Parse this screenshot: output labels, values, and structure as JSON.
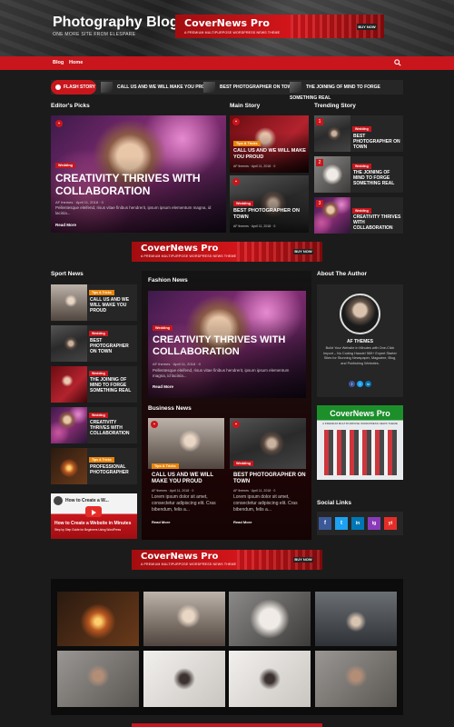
{
  "header": {
    "title": "Photography Blog",
    "tagline": "ONE MORE SITE FROM ELESPARE"
  },
  "ad": {
    "title": "CoverNews Pro",
    "subtitle": "A PREMIUM MULTIPURPOSE WORDPRESS NEWS THEME",
    "button": "BUY NOW"
  },
  "nav": {
    "items": [
      "Blog",
      "Home"
    ],
    "search_icon": "search-icon"
  },
  "flash": {
    "label": "FLASH STORY",
    "items": [
      "CALL US AND WE WILL MAKE YOU PROUD",
      "BEST PHOTOGRAPHER ON TOWN",
      "THE JOINING OF MIND TO FORGE SOMETHING REAL"
    ]
  },
  "sections": {
    "editors_picks": "Editor's Picks",
    "main_story": "Main Story",
    "trending_story": "Trending Story",
    "sport_news": "Sport News",
    "fashion_news": "Fashion News",
    "business_news": "Business News",
    "about_author": "About The Author",
    "social_links": "Social Links"
  },
  "editors": {
    "tag": "Wedding",
    "title": "CREATIVITY THRIVES WITH COLLABORATION",
    "author": "AF themes",
    "date": "April 11, 2018",
    "comments": "0",
    "excerpt": "Pellentesque eleifend, risus vitae finibus hendrerit, ipsum ipsum elementum magna, id lacinia...",
    "read_more": "Read More"
  },
  "main_story": [
    {
      "tag": "Tips & Tricks",
      "title": "CALL US AND WE WILL MAKE YOU PROUD",
      "author": "AF themes",
      "date": "April 11, 2018",
      "comments": "0"
    },
    {
      "tag": "Wedding",
      "title": "BEST PHOTOGRAPHER ON TOWN",
      "author": "AF themes",
      "date": "April 11, 2018",
      "comments": "0"
    }
  ],
  "trending": [
    {
      "num": "1",
      "tag": "Wedding",
      "title": "BEST PHOTOGRAPHER ON TOWN"
    },
    {
      "num": "2",
      "tag": "Wedding",
      "title": "THE JOINING OF MIND TO FORGE SOMETHING REAL"
    },
    {
      "num": "3",
      "tag": "Wedding",
      "title": "CREATIVITY THRIVES WITH COLLABORATION"
    }
  ],
  "sport": [
    {
      "tag": "Tips & Tricks",
      "title": "CALL US AND WE WILL MAKE YOU PROUD"
    },
    {
      "tag": "Wedding",
      "title": "BEST PHOTOGRAPHER ON TOWN"
    },
    {
      "tag": "Wedding",
      "title": "THE JOINING OF MIND TO FORGE SOMETHING REAL"
    },
    {
      "tag": "Wedding",
      "title": "CREATIVITY THRIVES WITH COLLABORATION"
    },
    {
      "tag": "Tips & Tricks",
      "title": "PROFESSIONAL PHOTOGRAPHER"
    }
  ],
  "video": {
    "title": "How to Create a Website in Minutes",
    "subtitle": "Step by Step Guide for Beginners Using WordPress",
    "top": "How to Create a W..."
  },
  "fashion": {
    "tag": "Wedding",
    "title": "CREATIVITY THRIVES WITH COLLABORATION",
    "author": "AF themes",
    "date": "April 11, 2018",
    "comments": "0",
    "excerpt": "Pellentesque eleifend, risus vitae finibus hendrerit, ipsum ipsum elementum magna, id lacinia...",
    "read_more": "Read More"
  },
  "business": [
    {
      "tag": "Tips & Tricks",
      "title": "CALL US AND WE WILL MAKE YOU PROUD",
      "author": "AF themes",
      "date": "April 11, 2018",
      "comments": "0",
      "excerpt": "Lorem ipsum dolor sit amet, consectetur adipiscing elit. Cras bibendum, felis a...",
      "read_more": "Read More"
    },
    {
      "tag": "Wedding",
      "title": "BEST PHOTOGRAPHER ON TOWN",
      "author": "AF themes",
      "date": "April 11, 2018",
      "comments": "0",
      "excerpt": "Lorem ipsum dolor sit amet, consectetur adipiscing elit. Cras bibendum, felis a...",
      "read_more": "Read More"
    }
  ],
  "author": {
    "name": "AF THEMES",
    "bio": "Build Your Website in Minutes with One-Click Import – No Coding Hassle! 565+ Expert Starter Sites for Stunning Newspaper, Magazine, Blog, and Publishing Websites."
  },
  "social": [
    "f",
    "t",
    "in",
    "ig",
    "yt"
  ],
  "colors": {
    "accent": "#c8161c",
    "bg": "#1b1b1b",
    "card": "#262626"
  }
}
